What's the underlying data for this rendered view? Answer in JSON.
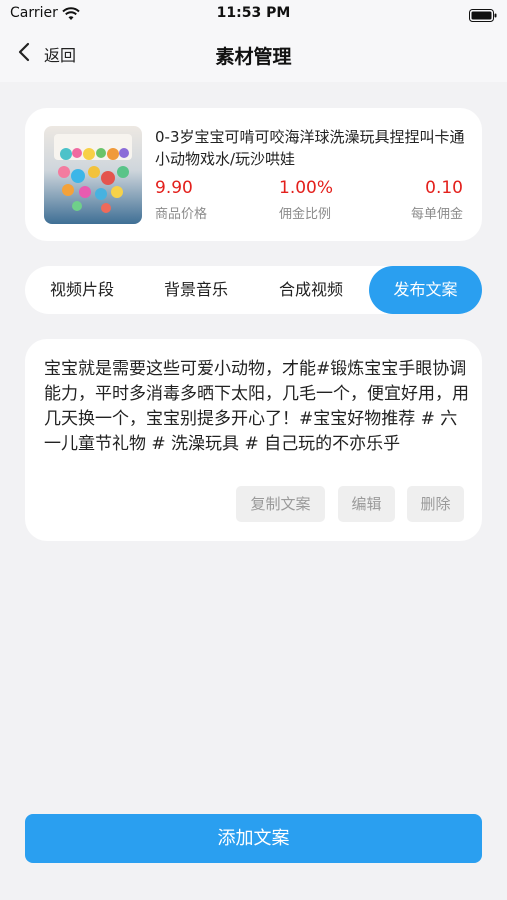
{
  "status_bar": {
    "carrier": "Carrier",
    "time": "11:53 PM"
  },
  "nav": {
    "back_label": "返回",
    "title": "素材管理"
  },
  "product": {
    "name": "0-3岁宝宝可啃可咬海洋球洗澡玩具捏捏叫卡通小动物戏水/玩沙哄娃",
    "stats": [
      {
        "value": "9.90",
        "label": "商品价格"
      },
      {
        "value": "1.00%",
        "label": "佣金比例"
      },
      {
        "value": "0.10",
        "label": "每单佣金"
      }
    ]
  },
  "tabs": [
    {
      "label": "视频片段",
      "active": false
    },
    {
      "label": "背景音乐",
      "active": false
    },
    {
      "label": "合成视频",
      "active": false
    },
    {
      "label": "发布文案",
      "active": true
    }
  ],
  "copy": {
    "text": "宝宝就是需要这些可爱小动物，才能#锻炼宝宝手眼协调能力，平时多消毒多晒下太阳，几毛一个，便宜好用，用几天换一个，宝宝别提多开心了！#宝宝好物推荐 # 六一儿童节礼物 # 洗澡玩具 # 自己玩的不亦乐乎",
    "actions": {
      "copy": "复制文案",
      "edit": "编辑",
      "delete": "删除"
    }
  },
  "add_button_label": "添加文案",
  "colors": {
    "accent": "#2a9ff0",
    "price": "#e3201c",
    "background": "#f2f2f4"
  }
}
